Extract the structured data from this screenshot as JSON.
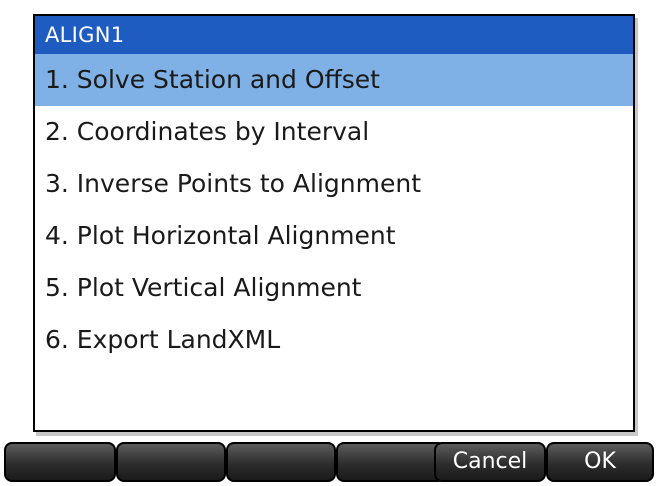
{
  "dialog": {
    "title": "ALIGN1",
    "items": [
      {
        "label": "1. Solve Station and Offset",
        "selected": true
      },
      {
        "label": "2. Coordinates by Interval",
        "selected": false
      },
      {
        "label": "3. Inverse Points to Alignment",
        "selected": false
      },
      {
        "label": "4. Plot Horizontal Alignment",
        "selected": false
      },
      {
        "label": "5. Plot Vertical Alignment",
        "selected": false
      },
      {
        "label": "6. Export LandXML",
        "selected": false
      }
    ]
  },
  "softkeys": [
    "",
    "",
    "",
    "",
    "Cancel",
    "OK"
  ],
  "colors": {
    "title_bar": "#1f5cc1",
    "selection": "#7fb1e6",
    "softkey_dark": "#1a1a1a"
  }
}
